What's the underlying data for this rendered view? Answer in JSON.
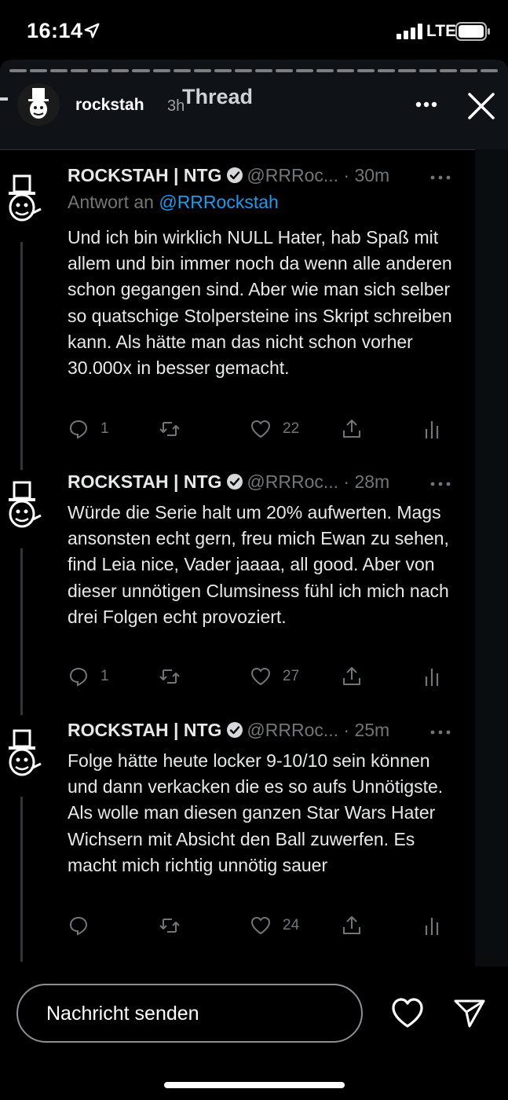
{
  "status_bar": {
    "time": "16:14",
    "network": "LTE"
  },
  "story": {
    "username": "rockstah",
    "age": "3h",
    "title": "Thread",
    "progress_segments": 24,
    "progress_done": 0
  },
  "tweets": [
    {
      "name": "ROCKSTAH | NTG",
      "handle": "@RRRoc...",
      "time": "· 30m",
      "reply_prefix": "Antwort an ",
      "reply_mention": "@RRRockstah",
      "text": "Und ich bin wirklich NULL Hater, hab Spaß mit allem und bin immer noch da wenn alle anderen schon gegangen sind. Aber wie man sich selber so quatschige Stolpersteine ins Skript schreiben kann. Als hätte man das nicht schon vorher 30.000x in besser gemacht.",
      "replies": "1",
      "retweets": "",
      "likes": "22"
    },
    {
      "name": "ROCKSTAH | NTG",
      "handle": "@RRRoc...",
      "time": "· 28m",
      "text": "Würde die Serie halt um 20% aufwerten. Mags ansonsten echt gern, freu mich Ewan zu sehen, find Leia nice, Vader jaaaa, all good. Aber von dieser unnötigen Clumsiness fühl ich mich nach drei Folgen echt provoziert.",
      "replies": "1",
      "retweets": "",
      "likes": "27"
    },
    {
      "name": "ROCKSTAH | NTG",
      "handle": "@RRRoc...",
      "time": "· 25m",
      "text": "Folge hätte heute locker 9-10/10 sein können und dann verkacken die es so aufs Unnötigste. Als wolle man diesen ganzen Star Wars Hater Wichsern mit Absicht den Ball zuwerfen. Es macht mich richtig unnötig sauer",
      "replies": "",
      "retweets": "",
      "likes": "24"
    }
  ],
  "bottom_bar": {
    "placeholder": "Nachricht senden"
  },
  "colors": {
    "accent": "#1d9bf0",
    "muted": "#71767b",
    "text": "#e7e9ea",
    "background": "#000000"
  },
  "icons": [
    "location-arrow-icon",
    "signal-icon",
    "battery-icon",
    "more-icon",
    "close-icon",
    "verified-icon",
    "reply-icon",
    "retweet-icon",
    "like-icon",
    "share-icon",
    "analytics-icon",
    "heart-icon",
    "send-icon"
  ]
}
